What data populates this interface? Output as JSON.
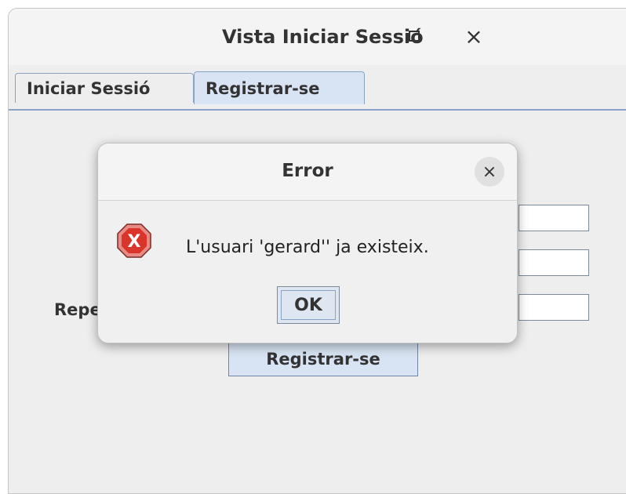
{
  "window": {
    "title": "Vista Iniciar Sessió",
    "controls": {
      "minimize": "–",
      "close": "×"
    }
  },
  "tabs": [
    {
      "label": "Iniciar Sessió",
      "selected": false
    },
    {
      "label": "Registrar-se",
      "selected": true
    }
  ],
  "form": {
    "repeat_label": "Repeat",
    "register_button": "Registrar-se"
  },
  "dialog": {
    "title": "Error",
    "close": "×",
    "icon": "error-x-icon",
    "icon_glyph": "X",
    "message": "L'usuari 'gerard'' ja existeix.",
    "ok_label": "OK"
  },
  "colors": {
    "selected_tab": "#d8e4f3",
    "error_icon": "#d9352b",
    "accent_border": "#8aa3c4"
  }
}
